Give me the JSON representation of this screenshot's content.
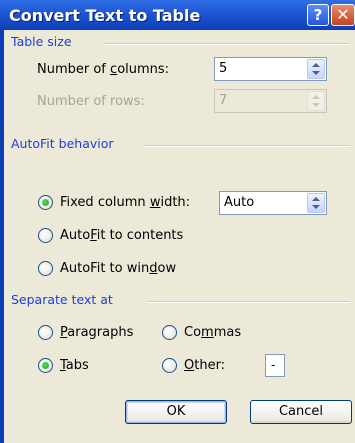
{
  "window": {
    "title": "Convert Text to Table",
    "help_glyph": "?",
    "close_glyph": "✕"
  },
  "table_size": {
    "label": "Table size",
    "columns": {
      "label": "Number of columns:",
      "value": "5"
    },
    "rows": {
      "label": "Number of rows:",
      "value": "7"
    }
  },
  "autofit": {
    "label": "AutoFit behavior",
    "options": [
      {
        "label": "Fixed column width:",
        "selected": true
      },
      {
        "label": "AutoFit to contents",
        "selected": false
      },
      {
        "label": "AutoFit to window",
        "selected": false
      }
    ],
    "fixed_width_value": "Auto"
  },
  "separate": {
    "label": "Separate text at",
    "options": [
      {
        "label": "Paragraphs",
        "selected": false
      },
      {
        "label": "Commas",
        "selected": false
      },
      {
        "label": "Tabs",
        "selected": true
      },
      {
        "label": "Other:",
        "selected": false
      }
    ],
    "other_value": "-"
  },
  "buttons": {
    "ok": "OK",
    "cancel": "Cancel"
  }
}
